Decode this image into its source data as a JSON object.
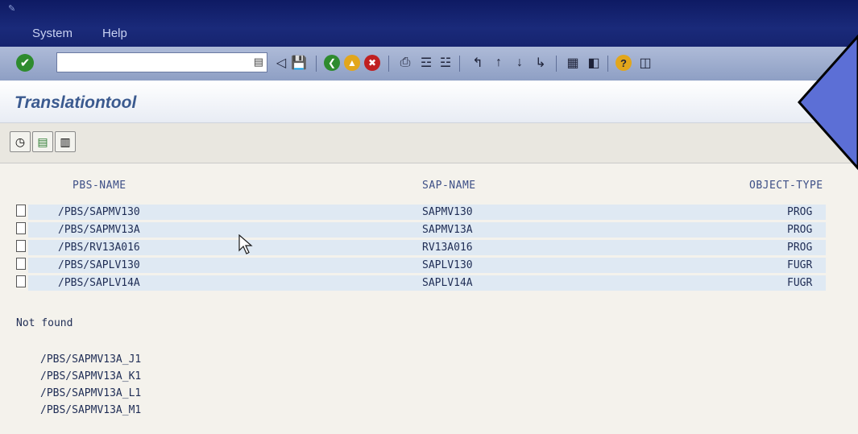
{
  "menu": {
    "system_label": "System",
    "help_label": "Help"
  },
  "toolbar": {
    "command_value": "",
    "command_placeholder": ""
  },
  "header": {
    "title": "Translationtool"
  },
  "table": {
    "columns": [
      "PBS-NAME",
      "SAP-NAME",
      "OBJECT-TYPE"
    ],
    "rows": [
      {
        "pbs": "/PBS/SAPMV130",
        "sap": "SAPMV130",
        "type": "PROG"
      },
      {
        "pbs": "/PBS/SAPMV13A",
        "sap": "SAPMV13A",
        "type": "PROG"
      },
      {
        "pbs": "/PBS/RV13A016",
        "sap": "RV13A016",
        "type": "PROG"
      },
      {
        "pbs": "/PBS/SAPLV130",
        "sap": "SAPLV130",
        "type": "FUGR"
      },
      {
        "pbs": "/PBS/SAPLV14A",
        "sap": "SAPLV14A",
        "type": "FUGR"
      }
    ]
  },
  "not_found": {
    "label": "Not found",
    "items": [
      "/PBS/SAPMV13A_J1",
      "/PBS/SAPMV13A_K1",
      "/PBS/SAPMV13A_L1",
      "/PBS/SAPMV13A_M1"
    ]
  },
  "icons": {
    "ok": "check-icon",
    "save": "save-icon",
    "back": "back-icon",
    "exit": "exit-icon",
    "cancel": "cancel-icon",
    "print": "print-icon",
    "find": "find-icon",
    "find_next": "find-next-icon",
    "help": "help-icon",
    "execute": "execute-icon"
  },
  "colors": {
    "menubar": "#16246f",
    "title": "#3b5a8f",
    "row": "#dfe9f3",
    "arrow": "#5c6fd6"
  }
}
